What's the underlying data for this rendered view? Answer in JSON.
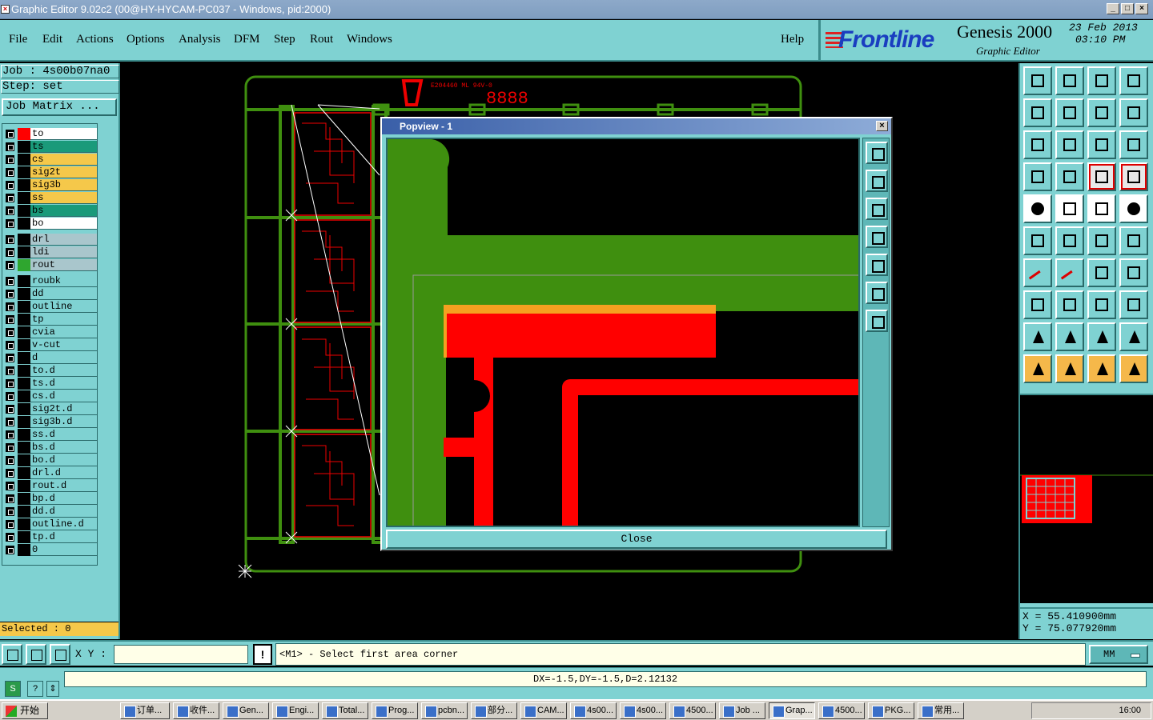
{
  "window": {
    "title": "Graphic Editor 9.02c2 (00@HY-HYCAM-PC037 - Windows, pid:2000)",
    "controls": [
      "_",
      "□",
      "×"
    ]
  },
  "menu": {
    "items": [
      "File",
      "Edit",
      "Actions",
      "Options",
      "Analysis",
      "DFM",
      "Step",
      "Rout",
      "Windows"
    ],
    "help": "Help"
  },
  "brand": {
    "logo": "Frontline",
    "product": "Genesis 2000",
    "subtitle": "Graphic Editor",
    "date": "23  Feb  2013",
    "time": "03:10  PM"
  },
  "left_panel": {
    "job": "Job  :  4s00b07na0",
    "step": "Step:  set",
    "job_matrix": "Job Matrix ...",
    "selected": "Selected : 0"
  },
  "layers": [
    {
      "name": "to",
      "swatch": "#ff0000",
      "bg": "#ffffff"
    },
    {
      "name": "ts",
      "swatch": "#000000",
      "bg": "#1a9a7a"
    },
    {
      "name": "cs",
      "swatch": "#000000",
      "bg": "#f5c84a"
    },
    {
      "name": "sig2t",
      "swatch": "#000000",
      "bg": "#f5c84a"
    },
    {
      "name": "sig3b",
      "swatch": "#000000",
      "bg": "#f5c84a"
    },
    {
      "name": "ss",
      "swatch": "#000000",
      "bg": "#f5c84a"
    },
    {
      "name": "bs",
      "swatch": "#000000",
      "bg": "#1a9a7a"
    },
    {
      "name": "bo",
      "swatch": "#000000",
      "bg": "#ffffff"
    },
    {
      "name": "drl",
      "swatch": "#000000",
      "bg": "#a9c6cc"
    },
    {
      "name": "ldi",
      "swatch": "#000000",
      "bg": "#a9c6cc"
    },
    {
      "name": "rout",
      "swatch": "#2fa62f",
      "bg": "#a9c6cc"
    },
    {
      "name": "roubk",
      "swatch": "#000000",
      "bg": "#7fd2d2"
    },
    {
      "name": "dd",
      "swatch": "#000000",
      "bg": "#7fd2d2"
    },
    {
      "name": "outline",
      "swatch": "#000000",
      "bg": "#7fd2d2"
    },
    {
      "name": "tp",
      "swatch": "#000000",
      "bg": "#7fd2d2"
    },
    {
      "name": "cvia",
      "swatch": "#000000",
      "bg": "#7fd2d2"
    },
    {
      "name": "v-cut",
      "swatch": "#000000",
      "bg": "#7fd2d2"
    },
    {
      "name": "d",
      "swatch": "#000000",
      "bg": "#7fd2d2"
    },
    {
      "name": "to.d",
      "swatch": "#000000",
      "bg": "#7fd2d2"
    },
    {
      "name": "ts.d",
      "swatch": "#000000",
      "bg": "#7fd2d2"
    },
    {
      "name": "cs.d",
      "swatch": "#000000",
      "bg": "#7fd2d2"
    },
    {
      "name": "sig2t.d",
      "swatch": "#000000",
      "bg": "#7fd2d2"
    },
    {
      "name": "sig3b.d",
      "swatch": "#000000",
      "bg": "#7fd2d2"
    },
    {
      "name": "ss.d",
      "swatch": "#000000",
      "bg": "#7fd2d2"
    },
    {
      "name": "bs.d",
      "swatch": "#000000",
      "bg": "#7fd2d2"
    },
    {
      "name": "bo.d",
      "swatch": "#000000",
      "bg": "#7fd2d2"
    },
    {
      "name": "drl.d",
      "swatch": "#000000",
      "bg": "#7fd2d2"
    },
    {
      "name": "rout.d",
      "swatch": "#000000",
      "bg": "#7fd2d2"
    },
    {
      "name": "bp.d",
      "swatch": "#000000",
      "bg": "#7fd2d2"
    },
    {
      "name": "dd.d",
      "swatch": "#000000",
      "bg": "#7fd2d2"
    },
    {
      "name": "outline.d",
      "swatch": "#000000",
      "bg": "#7fd2d2"
    },
    {
      "name": "tp.d",
      "swatch": "#000000",
      "bg": "#7fd2d2"
    },
    {
      "name": "0",
      "swatch": "#000000",
      "bg": "#7fd2d2"
    }
  ],
  "canvas": {
    "marking_text": "E204460 ML 94V-0",
    "digits": "8888"
  },
  "popview": {
    "title": "Popview - 1",
    "close_label": "Close"
  },
  "coords": {
    "x": "X  =  55.410900mm",
    "y": "Y  =  75.077920mm"
  },
  "status": {
    "xy_label": "X Y :",
    "xy_value": "",
    "message_icon": "!",
    "message": "<M1> - Select first area corner",
    "units": "MM",
    "measure": "DX=-1.5,DY=-1.5,D=2.12132",
    "help_icon": "?"
  },
  "taskbar": {
    "start": "开始",
    "tasks": [
      "订单...",
      "收件...",
      "Gen...",
      "Engi...",
      "Total...",
      "Prog...",
      "pcbn...",
      "部分...",
      "CAM...",
      "4s00...",
      "4s00...",
      "4500...",
      "Job ...",
      "Grap...",
      "4500...",
      "PKG...",
      "常用..."
    ],
    "clock": "16:00"
  },
  "colors": {
    "panel": "#7fd2d2",
    "rout_green": "#3f8f0f",
    "copper_red": "#ff0000",
    "highlight_orange": "#f5b84a"
  }
}
